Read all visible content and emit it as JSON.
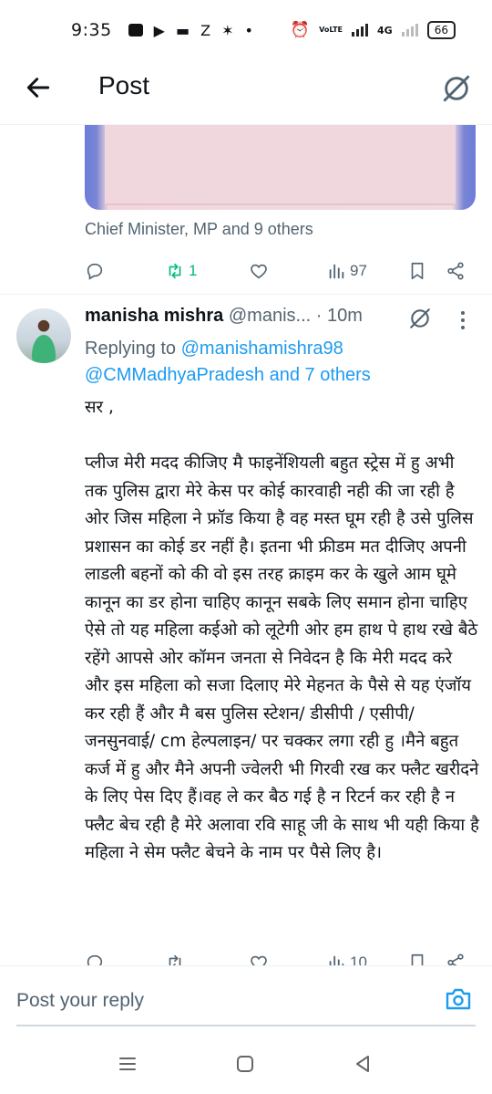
{
  "status_bar": {
    "time": "9:35",
    "network": "4G",
    "battery": "66",
    "volte": "VoLTE"
  },
  "header": {
    "title": "Post"
  },
  "previous_post": {
    "liked_by": "Chief Minister, MP and 9 others",
    "actions": {
      "retweets": "1",
      "views": "97"
    }
  },
  "reply": {
    "name": "manisha mishra",
    "handle": "@manis...",
    "time": "· 10m",
    "replying_prefix": "Replying to",
    "replying_to_1": "@manishamishra98",
    "replying_to_2": "@CMMadhyaPradesh and 7 others",
    "text": "सर ,\n\nप्लीज मेरी मदद कीजिए मै फाइनेंशियली बहुत स्ट्रेस में हु अभी तक पुलिस द्वारा मेरे केस पर कोई कारवाही नही की जा रही है ओर जिस महिला ने फ्रॉड किया है वह मस्त घूम रही है उसे पुलिस प्रशासन का कोई डर नहीं है। इतना भी फ्रीडम मत दीजिए अपनी लाडली बहनों को की वो इस तरह क्राइम कर के खुले आम घूमे कानून का डर होना चाहिए कानून सबके लिए समान होना चाहिए ऐसे तो यह महिला कईओ को लूटेगी ओर हम हाथ पे हाथ रखे बैठे रहेंगे आपसे ओर कॉमन जनता से निवेदन है कि मेरी मदद करे और इस महिला को सजा दिलाए मेरे मेहनत के पैसे से यह एंजॉय कर रही हैं और मै बस पुलिस स्टेशन/ डीसीपी / एसीपी/ जनसुनवाई/ cm हेल्पलाइन/ पर चक्कर लगा रही हु ।मैने बहुत कर्ज में हु और मैने अपनी ज्वेलरी भी गिरवी रख कर फ्लैट खरीदने के लिए पेस दिए हैं।वह ले कर बैठ गई है न रिटर्न कर रही है न फ्लैट बेच रही है मेरे अलावा रवि साहू जी के साथ भी यही किया है महिला ने सेम फ्लैट बेचने के नाम पर पैसे लिए है।",
    "views_partial": "10"
  },
  "composer": {
    "placeholder": "Post your reply"
  },
  "colors": {
    "text": "#0f1419",
    "secondary": "#536471",
    "link": "#1d9bf0",
    "retweet_green": "#00ba7c"
  }
}
